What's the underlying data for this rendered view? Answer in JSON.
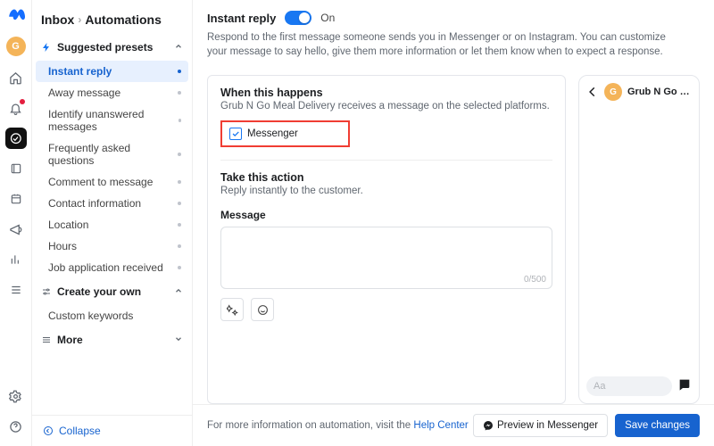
{
  "rail": {
    "avatar_initial": "G"
  },
  "breadcrumb": {
    "parent": "Inbox",
    "current": "Automations"
  },
  "sections": {
    "suggested": {
      "label": "Suggested presets",
      "items": [
        {
          "label": "Instant reply",
          "active": true,
          "has_dot": true
        },
        {
          "label": "Away message",
          "has_dot": true
        },
        {
          "label": "Identify unanswered messages",
          "has_dot": true
        },
        {
          "label": "Frequently asked questions",
          "has_dot": true
        },
        {
          "label": "Comment to message",
          "has_dot": true
        },
        {
          "label": "Contact information",
          "has_dot": true
        },
        {
          "label": "Location",
          "has_dot": true
        },
        {
          "label": "Hours",
          "has_dot": true
        },
        {
          "label": "Job application received",
          "has_dot": true
        }
      ]
    },
    "create": {
      "label": "Create your own",
      "items": [
        {
          "label": "Custom keywords"
        }
      ]
    },
    "more": {
      "label": "More"
    }
  },
  "collapse_label": "Collapse",
  "main": {
    "title": "Instant reply",
    "toggle_on_text": "On",
    "description": "Respond to the first message someone sends you in Messenger or on Instagram. You can customize your message to say hello, give them more information or let them know when to expect a response.",
    "when": {
      "title": "When this happens",
      "subtitle": "Grub N Go Meal Delivery receives a message on the selected platforms.",
      "platform": "Messenger"
    },
    "action": {
      "title": "Take this action",
      "subtitle": "Reply instantly to the customer."
    },
    "message": {
      "label": "Message",
      "counter": "0/500"
    }
  },
  "preview": {
    "avatar_initial": "G",
    "name": "Grub N Go M…",
    "placeholder": "Aa"
  },
  "footer": {
    "info_prefix": "For more information on automation, visit the ",
    "help_link": "Help Center",
    "preview_btn": "Preview in Messenger",
    "save_btn": "Save changes"
  }
}
